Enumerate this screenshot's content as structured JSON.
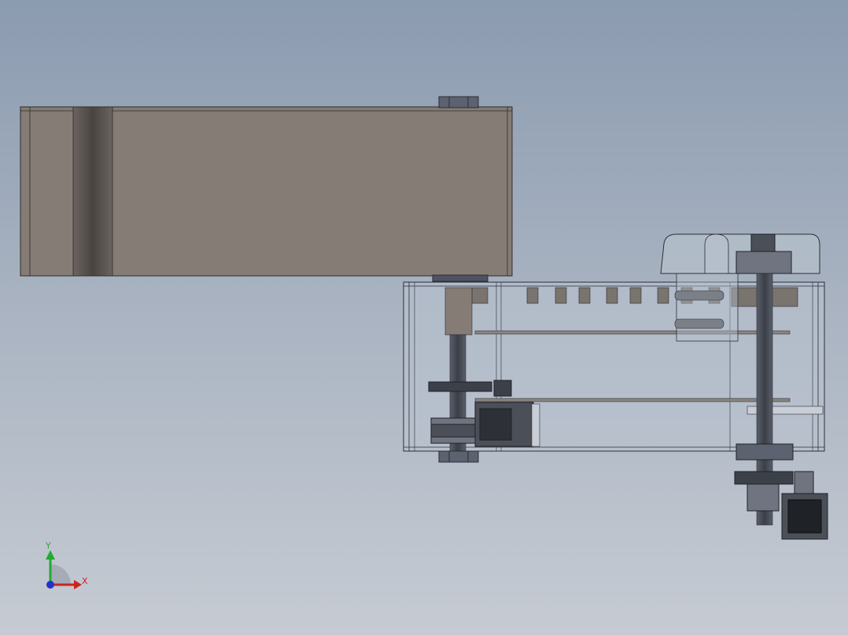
{
  "viewport": {
    "background_top": "#8b9bb0",
    "background_bottom": "#c6cbd3"
  },
  "colors": {
    "arm_body": "#857c76",
    "arm_edge": "#2f2a27",
    "glass": "#b9c3cf",
    "metal_dark": "#3c4049",
    "metal_mid": "#6f7480",
    "axis_x": "#cc2222",
    "axis_y": "#22aa33",
    "axis_z": "#2233cc"
  },
  "triad": {
    "x_label": "X",
    "y_label": "Y",
    "icon": "coordinate-triad-icon"
  }
}
